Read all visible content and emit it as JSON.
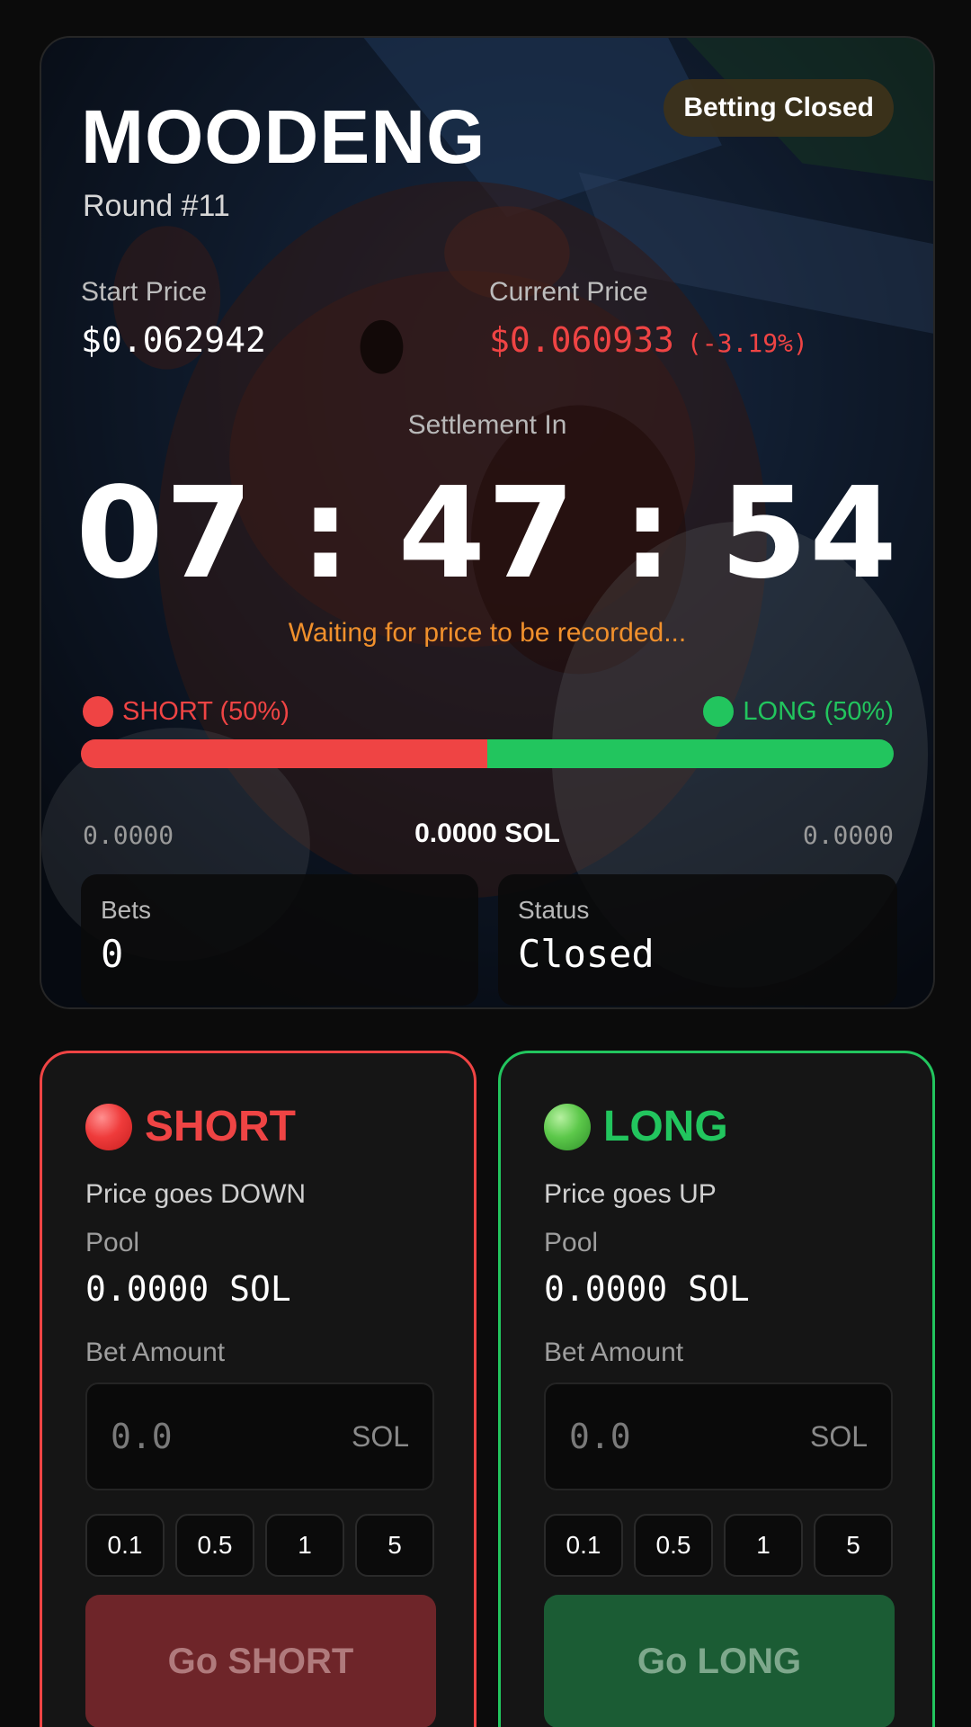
{
  "round_card": {
    "title": "MOODENG",
    "round": "Round #11",
    "badge": "Betting Closed",
    "start_price_label": "Start Price",
    "start_price": "$0.062942",
    "current_price_label": "Current Price",
    "current_price": "$0.060933",
    "change_pct": "(-3.19%)",
    "settlement_label": "Settlement In",
    "timer": "07:47:54",
    "waiting_text": "Waiting for price to be recorded...",
    "short_tag": "SHORT (50%)",
    "long_tag": "LONG (50%)",
    "short_share": 0.5,
    "short_pool": "0.0000",
    "total_pool": "0.0000 SOL",
    "long_pool": "0.0000",
    "bets_label": "Bets",
    "bets_value": "0",
    "status_label": "Status",
    "status_value": "Closed",
    "colors": {
      "short": "#ef4444",
      "long": "#22c55e",
      "accent": "#f0902c"
    }
  },
  "short_card": {
    "title": "SHORT",
    "desc": "Price goes DOWN",
    "pool_label": "Pool",
    "pool_value": "0.0000 SOL",
    "amount_label": "Bet Amount",
    "amount_placeholder": "0.0",
    "unit": "SOL",
    "quick": [
      "0.1",
      "0.5",
      "1",
      "5"
    ],
    "action": "Go SHORT"
  },
  "long_card": {
    "title": "LONG",
    "desc": "Price goes UP",
    "pool_label": "Pool",
    "pool_value": "0.0000 SOL",
    "amount_label": "Bet Amount",
    "amount_placeholder": "0.0",
    "unit": "SOL",
    "quick": [
      "0.1",
      "0.5",
      "1",
      "5"
    ],
    "action": "Go LONG"
  }
}
